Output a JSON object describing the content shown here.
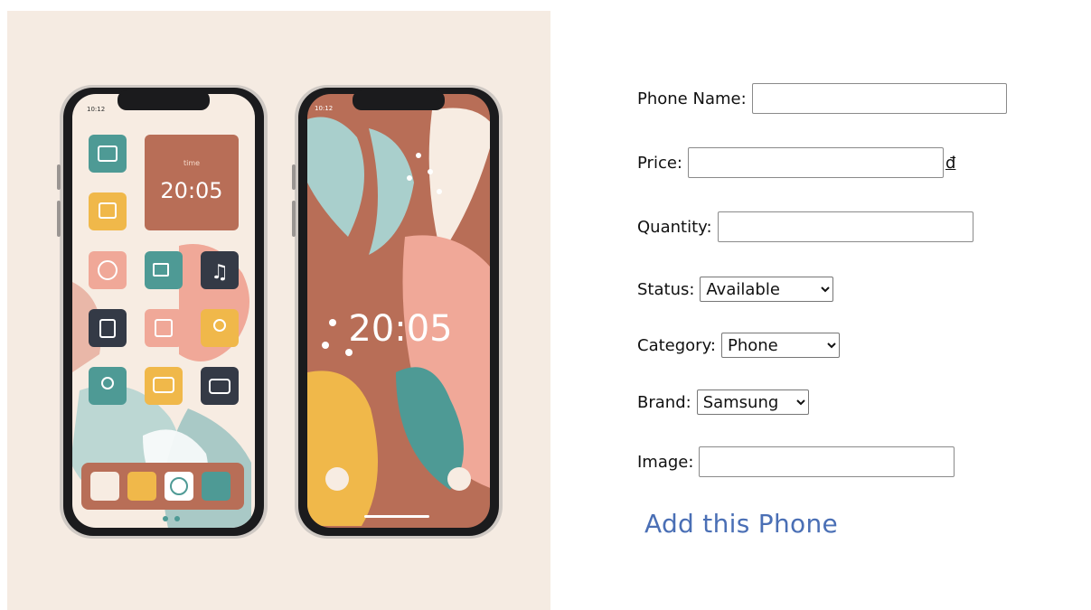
{
  "banner": {
    "left_phone": {
      "status_time": "10:12",
      "widget_label": "time",
      "widget_time": "20:05"
    },
    "right_phone": {
      "status_time": "10:12",
      "clock": "20:05"
    }
  },
  "form": {
    "phone_name": {
      "label": "Phone Name:",
      "value": ""
    },
    "price": {
      "label": "Price:",
      "value": "",
      "currency": "đ"
    },
    "quantity": {
      "label": "Quantity:",
      "value": ""
    },
    "status": {
      "label": "Status:",
      "selected": "Available"
    },
    "category": {
      "label": "Category:",
      "selected": "Phone"
    },
    "brand": {
      "label": "Brand:",
      "selected": "Samsung"
    },
    "image": {
      "label": "Image:",
      "value": ""
    },
    "submit_label": "Add this Phone"
  },
  "colors": {
    "banner_bg": "#f5ebe2",
    "teal": "#4e9a95",
    "terracotta": "#b86e57",
    "pink": "#f0a898",
    "mustard": "#f0b84a",
    "navy": "#343a46",
    "link": "#4a6fb5"
  }
}
